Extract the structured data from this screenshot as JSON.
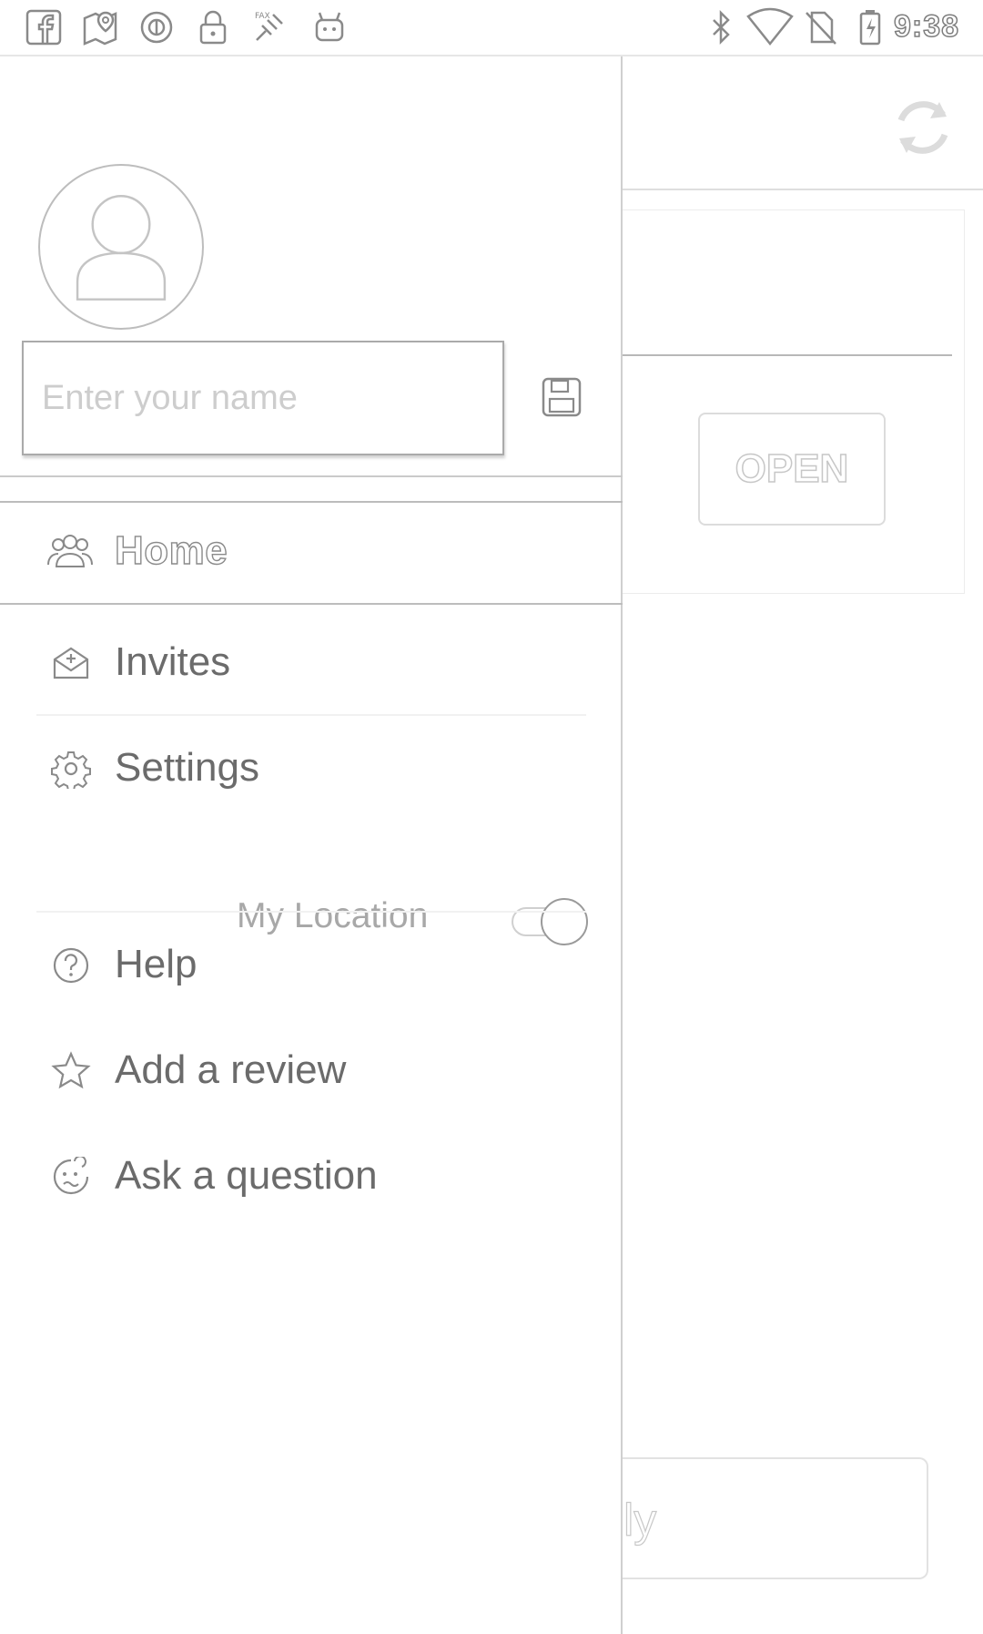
{
  "status_bar": {
    "left_icons": [
      "facebook-icon",
      "maps-icon",
      "data-saver-icon",
      "lock-icon",
      "satellite-icon",
      "android-icon"
    ],
    "right_icons": [
      "bluetooth-icon",
      "wifi-icon",
      "no-sim-icon",
      "battery-charging-icon"
    ],
    "time": "9:38"
  },
  "background": {
    "open_button_label": "OPEN",
    "bottom_button_label": "ily"
  },
  "drawer": {
    "name_placeholder": "Enter your name",
    "home_label": "Home",
    "items": [
      {
        "label": "Invites",
        "icon": "mail-add-icon"
      },
      {
        "label": "Settings",
        "icon": "gear-icon"
      },
      {
        "label": "Help",
        "icon": "help-circle-icon"
      },
      {
        "label": "Add a review",
        "icon": "star-icon"
      },
      {
        "label": "Ask a question",
        "icon": "confused-face-icon"
      }
    ],
    "location_label": "My Location",
    "location_enabled": true
  }
}
